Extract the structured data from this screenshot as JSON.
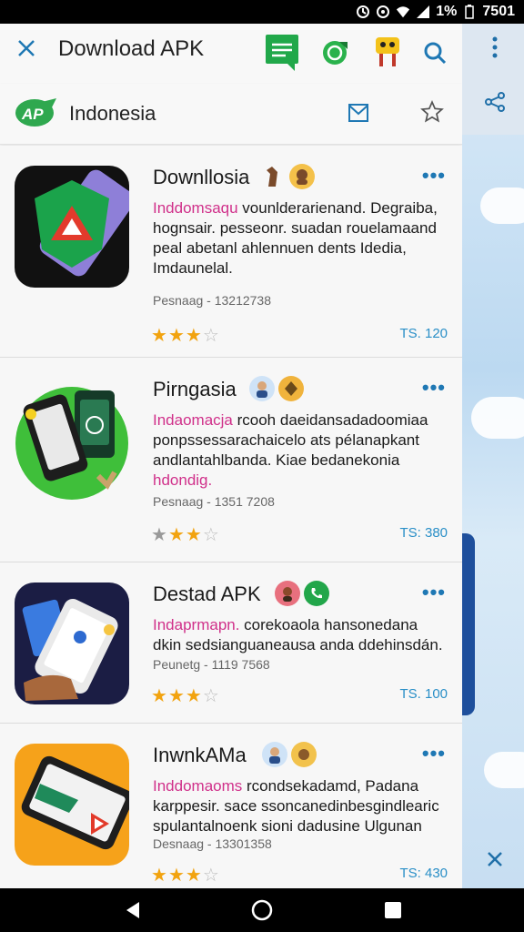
{
  "status": {
    "battery": "1%",
    "time": "7501"
  },
  "header": {
    "title": "Download APK",
    "region": "Indonesia"
  },
  "apps": [
    {
      "name": "Downllosia",
      "desc_pink": "Inddomsaqu",
      "desc_rest": " vounlderarienand. Degraiba, hognsair. pesseonr. suadan rouelamaand peal abetanl ahlennuen dents Idedia, Imdaunelal.",
      "meta": "Pesnaag - 13212738",
      "rating": 3,
      "price": "TS. 120",
      "icon_color": "#111111",
      "icon_name": "triangle-shield-icon"
    },
    {
      "name": "Pirngasia",
      "desc_pink": "Indaomacja",
      "desc_rest": " rcooh daeidansadadoomiaa ponpssessarachaicelo ats pélanapkant andlantahlbanda. Kiae bedanekonia",
      "desc_pink2": "hdondig.",
      "meta": "Pesnaag - 1351 7208",
      "rating": 3,
      "price": "TS: 380",
      "icon_color": "#36b23c",
      "icon_name": "phone-wallet-icon"
    },
    {
      "name": "Destad APK",
      "desc_pink": "Indaprmapn.",
      "desc_rest": " corekoaola hansonedana dkin sedsianguaneausa anda ddehinsdán.",
      "meta": "Peunetg - 1119 7568",
      "rating": 3,
      "price": "TS. 100",
      "icon_color": "#1b1d44",
      "icon_name": "hand-phone-icon"
    },
    {
      "name": "InwnkAMa",
      "desc_pink": "Inddomaoms",
      "desc_rest": " rcondsekadamd, Padana karppesir. sace ssoncanedinbesgindlearic spulantalnoenk sioni dadusine Ulgunan",
      "meta": "Desnaag - 13301358",
      "rating": 3,
      "price": "TS: 430",
      "icon_color": "#f6a21a",
      "icon_name": "phone-triangle-icon"
    }
  ],
  "colors": {
    "accent": "#1f78b4",
    "pink": "#d0308a",
    "star": "#f2a30f",
    "price": "#2a8fc7"
  }
}
